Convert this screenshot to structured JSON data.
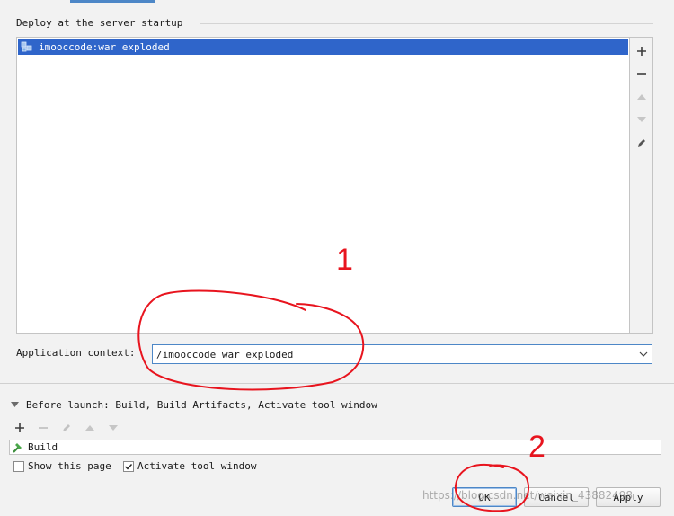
{
  "deploy": {
    "title": "Deploy at the server startup",
    "artifacts": [
      {
        "name": "imooccode:war exploded",
        "selected": true,
        "icon": "artifact-exploded-icon"
      }
    ],
    "toolbar_icons": [
      "add-icon",
      "remove-icon",
      "move-up-icon",
      "move-down-icon",
      "edit-icon"
    ]
  },
  "context": {
    "label": "Application context:",
    "value": "/imooccode_war_exploded"
  },
  "before_launch": {
    "title": "Before launch: Build, Build Artifacts, Activate tool window",
    "collapsed": false,
    "toolbar_icons": [
      "add-icon",
      "remove-icon",
      "edit-icon",
      "move-up-icon",
      "move-down-icon"
    ],
    "tasks": [
      {
        "name": "Build",
        "icon": "hammer-icon"
      }
    ],
    "show_page_label": "Show this page",
    "show_page_checked": false,
    "activate_label": "Activate tool window",
    "activate_checked": true
  },
  "buttons": {
    "ok": "OK",
    "cancel": "Cancel",
    "apply": "Apply"
  },
  "annotations": {
    "mark_1": "1",
    "mark_2": "2",
    "color": "#e8141e"
  },
  "watermark": "https://blog.csdn.net/weixin_43882498",
  "colors": {
    "selection": "#2f65ca",
    "accent": "#4d87c7",
    "background": "#f2f2f2"
  }
}
